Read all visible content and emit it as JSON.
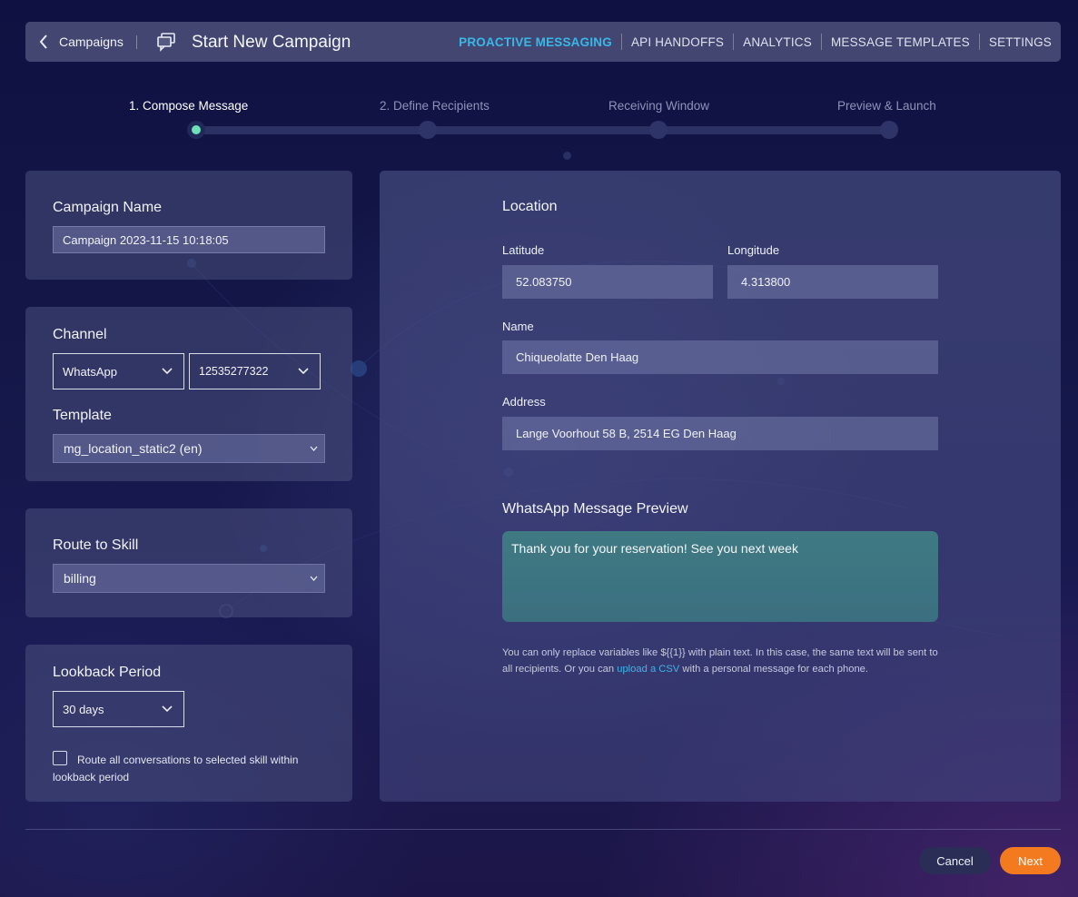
{
  "header": {
    "back_label": "Campaigns",
    "title": "Start New Campaign",
    "nav": [
      {
        "label": "PROACTIVE MESSAGING",
        "active": true
      },
      {
        "label": "API HANDOFFS",
        "active": false
      },
      {
        "label": "ANALYTICS",
        "active": false
      },
      {
        "label": "MESSAGE TEMPLATES",
        "active": false
      },
      {
        "label": "SETTINGS",
        "active": false
      }
    ]
  },
  "steps": [
    {
      "label": "1. Compose Message",
      "active": true
    },
    {
      "label": "2. Define Recipients",
      "active": false
    },
    {
      "label": "Receiving Window",
      "active": false
    },
    {
      "label": "Preview & Launch",
      "active": false
    }
  ],
  "campaign": {
    "heading": "Campaign Name",
    "value": "Campaign 2023-11-15 10:18:05"
  },
  "channel": {
    "heading": "Channel",
    "channel_value": "WhatsApp",
    "number_value": "12535277322",
    "template_heading": "Template",
    "template_value": "mg_location_static2 (en)"
  },
  "route": {
    "heading": "Route to Skill",
    "value": "billing"
  },
  "lookback": {
    "heading": "Lookback Period",
    "value": "30 days",
    "checkbox_label": "Route all conversations to selected skill within lookback period",
    "checked": false
  },
  "location": {
    "heading": "Location",
    "latitude_label": "Latitude",
    "latitude": "52.083750",
    "longitude_label": "Longitude",
    "longitude": "4.313800",
    "name_label": "Name",
    "name": "Chiqueolatte Den Haag",
    "address_label": "Address",
    "address": "Lange Voorhout 58 B, 2514 EG Den Haag"
  },
  "preview": {
    "heading": "WhatsApp Message Preview",
    "message": "Thank you for your reservation! See you next week",
    "note_before": "You can only replace variables like ${{1}} with plain text. In this case, the same text will be sent to all recipients. Or you can ",
    "note_link": "upload a CSV",
    "note_after": " with a personal message for each phone."
  },
  "footer": {
    "cancel_label": "Cancel",
    "next_label": "Next"
  },
  "colors": {
    "accent": "#39b8e8",
    "step_active": "#6fe0b7",
    "next_button": "#f47a1f",
    "link": "#3fb4ea"
  }
}
